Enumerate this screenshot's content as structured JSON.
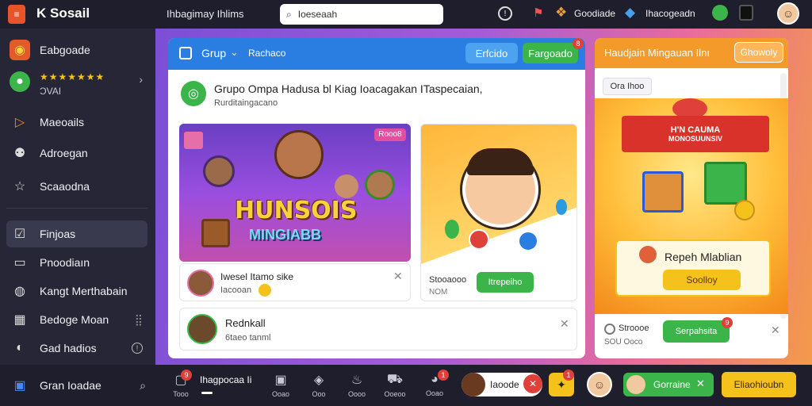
{
  "app": {
    "logo_text": "K Sosail",
    "header_title": "Ihbagimay Ihlims"
  },
  "search": {
    "value": "Ioeseaah"
  },
  "topbar": {
    "item1": "Goodiade",
    "item2": "Ihacogeadn"
  },
  "sidebar": {
    "items": [
      {
        "label": "Eabgoade",
        "icon": "app-logo-icon"
      },
      {
        "label": "★★★★★★★",
        "sublabel": "ƆVAI",
        "icon": "user-avatar"
      },
      {
        "label": "Maeoails",
        "icon": "play-icon"
      },
      {
        "label": "Adroegan",
        "icon": "people-icon"
      },
      {
        "label": "Scaaodna",
        "icon": "star-icon"
      },
      {
        "label": "Finjoas",
        "icon": "checkbox-icon"
      },
      {
        "label": "Pnoodiaın",
        "icon": "monitor-icon"
      },
      {
        "label": "Kangt Merthabain",
        "icon": "compass-icon"
      },
      {
        "label": "Bedoge Moan",
        "icon": "grid-icon"
      },
      {
        "label": "Gad hadios",
        "icon": "moon-icon"
      },
      {
        "label": "Gran Ioadae",
        "icon": "cube-icon"
      }
    ]
  },
  "group_panel": {
    "header_title": "Grup",
    "header_sub": "Rachaco",
    "btn1": "Erfcido",
    "btn2": "Fargoado",
    "btn2_badge": "8",
    "title": "Grupo Ompa Hadusa bl Kiag Ioacagakan ITaspecaian,",
    "subtitle": "Rurditaingacano",
    "game_banner_text": "HUNSOIS",
    "game_banner_sub": "MINGIABB",
    "game_tag": "Rooo8",
    "game_card_name": "Iwesel Itamo sike",
    "game_card_sub": "Iacooan",
    "side_card_label": "Stooaooo",
    "side_card_sub": "NOM",
    "side_card_btn": "Itrepeiho",
    "notif_name": "Rednkall",
    "notif_sub": "6taeo tanml"
  },
  "promo_panel": {
    "title": "Haudjain Mingauan Ilnı",
    "btn": "Ghowoly",
    "tag": "Ora Ihoo",
    "ribbon_line1": "H'N CAUMA",
    "ribbon_line2": "MONOSUUNSIV",
    "reward_title": "Repeh Mlablian",
    "reward_btn": "Soolloy",
    "foot_label": "Stroooe",
    "foot_sub": "SOU Ooco",
    "foot_btn": "Serpahsita",
    "foot_badge": "9"
  },
  "bottombar": {
    "items": [
      {
        "label": "Tooo",
        "badge": "9",
        "icon": "chat-icon"
      },
      {
        "label": "Ihagpocaa Ii",
        "icon": "text-tab"
      },
      {
        "label": "Ooao",
        "icon": "chat-icon"
      },
      {
        "label": "Ooo",
        "icon": "gamepad-icon"
      },
      {
        "label": "Oooo",
        "icon": "fire-icon"
      },
      {
        "label": "Ooeoo",
        "icon": "car-icon"
      },
      {
        "label": "Ooao",
        "badge": "1",
        "icon": "ball-icon"
      }
    ],
    "chip1": "Iaoode",
    "chip2_badge": "1",
    "chip3": "Gorraine",
    "cta": "Eliaohioubn"
  },
  "colors": {
    "accent_green": "#3bb54a",
    "accent_blue": "#2a7de1",
    "accent_yellow": "#f4c21b",
    "accent_red": "#e0403a"
  }
}
